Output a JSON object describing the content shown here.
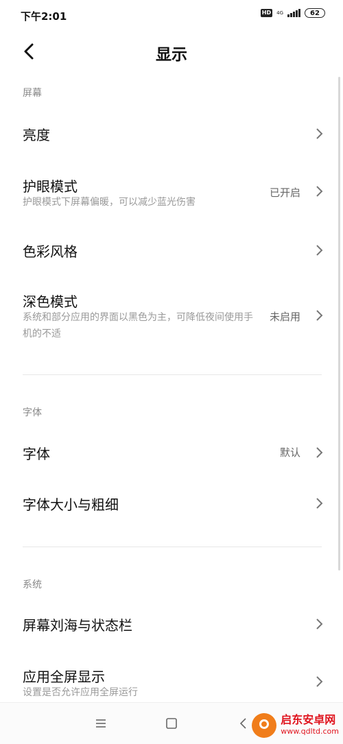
{
  "status_bar": {
    "time": "下午2:01",
    "hd": "HD",
    "network": "4G",
    "battery": "62"
  },
  "header": {
    "title": "显示"
  },
  "sections": {
    "screen": {
      "header": "屏幕",
      "items": [
        {
          "title": "亮度"
        },
        {
          "title": "护眼模式",
          "subtitle": "护眼模式下屏幕偏暖，可以减少蓝光伤害",
          "value": "已开启"
        },
        {
          "title": "色彩风格"
        },
        {
          "title": "深色模式",
          "subtitle": "系统和部分应用的界面以黑色为主，可降低夜间使用手机的不适",
          "value": "未启用"
        }
      ]
    },
    "font": {
      "header": "字体",
      "items": [
        {
          "title": "字体",
          "value": "默认"
        },
        {
          "title": "字体大小与粗细"
        }
      ]
    },
    "system": {
      "header": "系统",
      "items": [
        {
          "title": "屏幕刘海与状态栏"
        },
        {
          "title": "应用全屏显示",
          "subtitle": "设置是否允许应用全屏运行"
        }
      ]
    }
  },
  "watermark": {
    "name": "启东安卓网",
    "url": "www.qdltd.com"
  },
  "colors": {
    "accent_watermark": "#e0141e",
    "logo": "#f07d1a",
    "section_header": "#888888"
  }
}
